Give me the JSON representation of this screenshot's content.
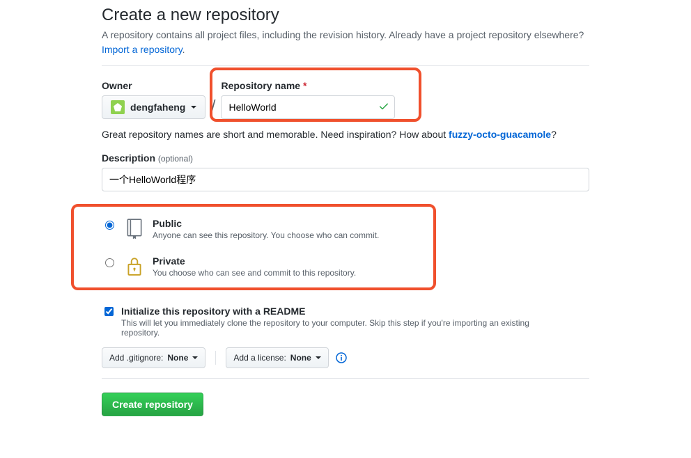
{
  "page": {
    "title": "Create a new repository",
    "subhead_text": "A repository contains all project files, including the revision history. Already have a project repository elsewhere? ",
    "import_link": "Import a repository",
    "period": "."
  },
  "owner": {
    "label": "Owner",
    "username": "dengfaheng"
  },
  "repo_name": {
    "label": "Repository name",
    "value": "HelloWorld"
  },
  "hint": {
    "prefix": "Great repository names are short and memorable. Need inspiration? How about ",
    "suggestion": "fuzzy-octo-guacamole",
    "suffix": "?"
  },
  "description": {
    "label": "Description",
    "optional": "(optional)",
    "value": "一个HelloWorld程序"
  },
  "visibility": {
    "public": {
      "title": "Public",
      "sub": "Anyone can see this repository. You choose who can commit."
    },
    "private": {
      "title": "Private",
      "sub": "You choose who can see and commit to this repository."
    },
    "selected": "public"
  },
  "init": {
    "title": "Initialize this repository with a README",
    "sub": "This will let you immediately clone the repository to your computer. Skip this step if you're importing an existing repository.",
    "checked": true
  },
  "buttons": {
    "gitignore_prefix": "Add .gitignore: ",
    "gitignore_value": "None",
    "license_prefix": "Add a license: ",
    "license_value": "None",
    "create": "Create repository"
  }
}
